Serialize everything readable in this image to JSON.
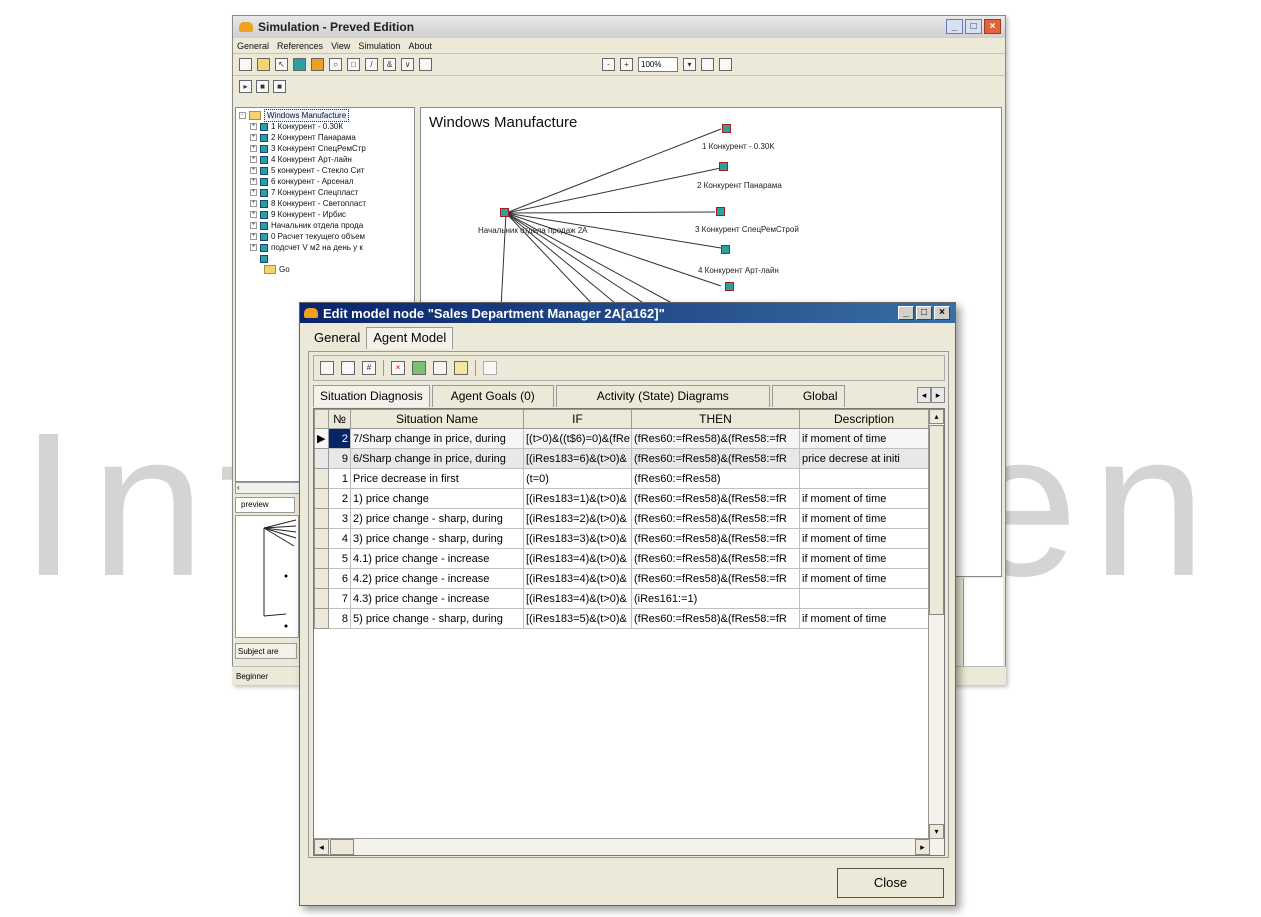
{
  "watermark": "IntechOpen",
  "main": {
    "title": "Simulation - Preved Edition",
    "menu": [
      "General",
      "References",
      "View",
      "Simulation",
      "About"
    ],
    "zoom": "100%",
    "canvas_title": "Windows Manufacture",
    "tree": {
      "root": "Windows Manufacture",
      "items": [
        "1 Конкурент - 0.30К",
        "2 Конкурент Панарама",
        "3 Конкурент СпецРемСтр",
        "4 Конкурент Арт-лайн",
        "5 конкурент - Стекло Сит",
        "6 конкурент - Арсенал",
        "7 Конкурент Спецпласт",
        "8 Конкурент - Светопласт",
        "9 Конкурент - Ирбис",
        "Начальник отдела прода",
        "0 Расчет текущего объем",
        "подсчет V м2 на день у к"
      ],
      "folder": "Go"
    },
    "nodes": [
      {
        "label": "1 Конкурент - 0.30K"
      },
      {
        "label": "2 Конкурент Панарама"
      },
      {
        "label": "3 Конкурент СпецРемСтрой"
      },
      {
        "label": "4 Конкурент Арт-лайн"
      },
      {
        "label": "Начальник отдела продаж 2А"
      }
    ],
    "left_tab": "preview",
    "subject_tab": "Subject are",
    "status": "Beginner"
  },
  "dialog": {
    "title": "Edit model node \"Sales Department Manager 2A[a162]\"",
    "tabs": [
      "General",
      "Agent Model"
    ],
    "subtabs": [
      "Situation Diagnosis",
      "Agent Goals (0)",
      "Activity (State) Diagrams",
      "Global"
    ],
    "columns": [
      "№",
      "Situation Name",
      "IF",
      "THEN",
      "Description"
    ],
    "rows": [
      [
        "2",
        "7/Sharp change in price, during",
        "[(t>0)&((t$6)=0)&(fRe",
        "(fRes60:=fRes58)&(fRes58:=fR",
        "if moment of time"
      ],
      [
        "9",
        "6/Sharp change in price, during",
        "[(iRes183=6)&(t>0)&",
        "(fRes60:=fRes58)&(fRes58:=fR",
        "price decrese at initi"
      ],
      [
        "1",
        "Price decrease in first",
        "(t=0)",
        "(fRes60:=fRes58)",
        ""
      ],
      [
        "2",
        "1) price change",
        "[(iRes183=1)&(t>0)&",
        "(fRes60:=fRes58)&(fRes58:=fR",
        "if moment of time"
      ],
      [
        "3",
        "2) price change - sharp, during",
        "[(iRes183=2)&(t>0)&",
        "(fRes60:=fRes58)&(fRes58:=fR",
        "if moment of time"
      ],
      [
        "4",
        "3) price change - sharp, during",
        "[(iRes183=3)&(t>0)&",
        "(fRes60:=fRes58)&(fRes58:=fR",
        "if moment of time"
      ],
      [
        "5",
        "4.1) price change - increase",
        "[(iRes183=4)&(t>0)&",
        "(fRes60:=fRes58)&(fRes58:=fR",
        "if moment of time"
      ],
      [
        "6",
        "4.2) price change - increase",
        "[(iRes183=4)&(t>0)&",
        "(fRes60:=fRes58)&(fRes58:=fR",
        "if moment of time"
      ],
      [
        "7",
        "4.3) price change - increase",
        "[(iRes183=4)&(t>0)&",
        "(iRes161:=1)",
        ""
      ],
      [
        "8",
        "5) price change - sharp, during",
        "[(iRes183=5)&(t>0)&",
        "(fRes60:=fRes58)&(fRes58:=fR",
        "if moment of time"
      ]
    ],
    "close": "Close"
  }
}
